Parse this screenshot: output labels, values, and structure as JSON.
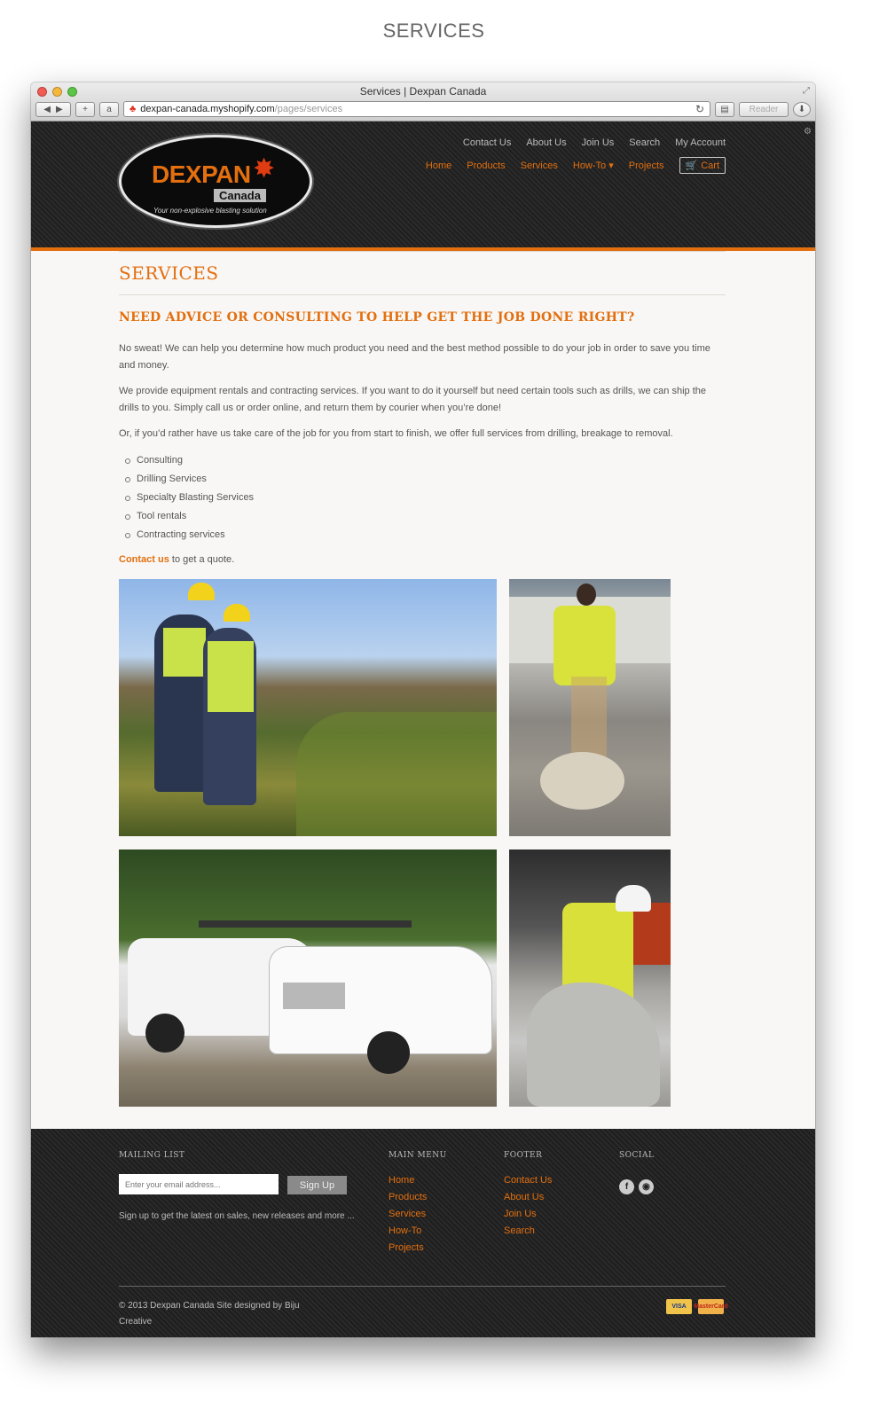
{
  "caption": "SERVICES",
  "browser": {
    "title": "Services | Dexpan Canada",
    "url_host": "dexpan-canada.myshopify.com",
    "url_path": "/pages/services",
    "reader_label": "Reader"
  },
  "header": {
    "logo_word": "DEXPAN",
    "logo_sub": "Canada",
    "logo_tagline": "Your non-explosive blasting solution",
    "util_nav": [
      "Contact Us",
      "About Us",
      "Join Us",
      "Search",
      "My Account"
    ],
    "main_nav": [
      "Home",
      "Products",
      "Services",
      "How-To",
      "Projects"
    ],
    "howto_caret": "▾",
    "cart_label": "Cart"
  },
  "main": {
    "page_title": "SERVICES",
    "subtitle": "NEED ADVICE OR CONSULTING TO HELP GET THE JOB DONE RIGHT?",
    "paragraph_1": "No sweat! We can help you determine how much product you need and the best method possible to do your job in order to save you time and money.",
    "paragraph_2": "We provide equipment rentals and contracting services. If you want to do it yourself but need certain tools such as drills, we can ship the drills to you. Simply call us or order online, and return them by courier when you’re done!",
    "paragraph_3": "Or, if you’d rather have us take care of the job for you from start to finish, we offer full services from drilling, breakage to removal.",
    "services": [
      "Consulting",
      "Drilling Services",
      "Specialty Blasting Services",
      "Tool rentals",
      "Contracting services"
    ],
    "contact_link": "Contact us",
    "contact_suffix": " to get a quote."
  },
  "footer": {
    "mailing_heading": "MAILING LIST",
    "email_placeholder": "Enter your email address...",
    "signup_label": "Sign Up",
    "mailing_note": "Sign up to get the latest on sales, new releases and more ...",
    "main_menu_heading": "MAIN MENU",
    "main_menu": [
      "Home",
      "Products",
      "Services",
      "How-To",
      "Projects"
    ],
    "footer_heading": "FOOTER",
    "footer_menu": [
      "Contact Us",
      "About Us",
      "Join Us",
      "Search"
    ],
    "social_heading": "SOCIAL",
    "social_icons": [
      "facebook-icon",
      "rss-icon"
    ],
    "copyright": "© 2013 Dexpan Canada Site designed by Biju Creative",
    "cards": [
      "VISA",
      "MasterCard"
    ]
  },
  "colors": {
    "accent": "#e36f0f",
    "header_bg": "#222222",
    "page_bg": "#f8f7f5"
  }
}
